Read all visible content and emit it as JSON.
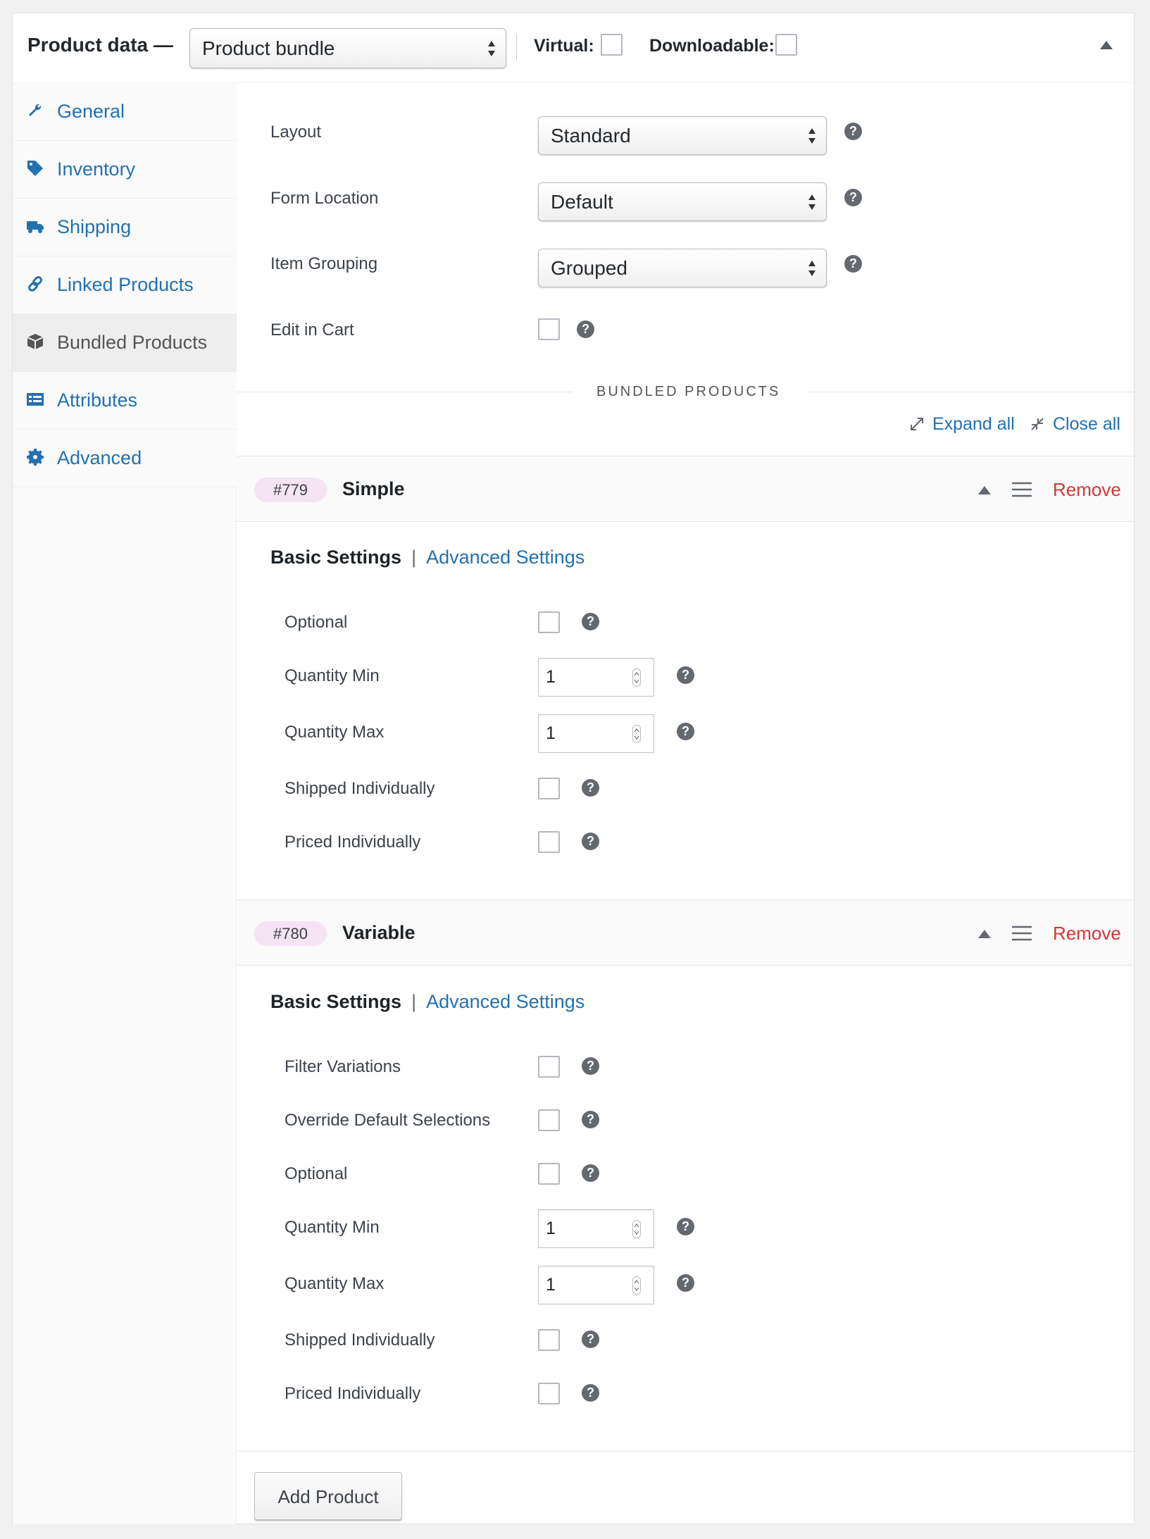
{
  "header": {
    "title": "Product data —",
    "product_type": "Product bundle",
    "virtual_label": "Virtual:",
    "downloadable_label": "Downloadable:"
  },
  "sidebar": {
    "items": [
      {
        "label": "General",
        "icon": "wrench-icon"
      },
      {
        "label": "Inventory",
        "icon": "tag-icon"
      },
      {
        "label": "Shipping",
        "icon": "truck-icon"
      },
      {
        "label": "Linked Products",
        "icon": "link-icon"
      },
      {
        "label": "Bundled Products",
        "icon": "box-icon",
        "active": true
      },
      {
        "label": "Attributes",
        "icon": "list-icon"
      },
      {
        "label": "Advanced",
        "icon": "gear-icon"
      }
    ]
  },
  "settings": {
    "layout": {
      "label": "Layout",
      "value": "Standard"
    },
    "form_location": {
      "label": "Form Location",
      "value": "Default"
    },
    "item_grouping": {
      "label": "Item Grouping",
      "value": "Grouped"
    },
    "edit_in_cart": {
      "label": "Edit in Cart"
    }
  },
  "section_title": "BUNDLED PRODUCTS",
  "actions": {
    "expand_all": "Expand all",
    "close_all": "Close all"
  },
  "help_glyph": "?",
  "items": [
    {
      "id": "#779",
      "title": "Simple",
      "remove": "Remove",
      "basic_tab": "Basic Settings",
      "separator": "|",
      "advanced_tab": "Advanced Settings",
      "fields": {
        "optional": "Optional",
        "qty_min": "Quantity Min",
        "qty_min_value": "1",
        "qty_max": "Quantity Max",
        "qty_max_value": "1",
        "shipped": "Shipped Individually",
        "priced": "Priced Individually"
      }
    },
    {
      "id": "#780",
      "title": "Variable",
      "remove": "Remove",
      "basic_tab": "Basic Settings",
      "separator": "|",
      "advanced_tab": "Advanced Settings",
      "fields": {
        "filter": "Filter Variations",
        "override": "Override Default Selections",
        "optional": "Optional",
        "qty_min": "Quantity Min",
        "qty_min_value": "1",
        "qty_max": "Quantity Max",
        "qty_max_value": "1",
        "shipped": "Shipped Individually",
        "priced": "Priced Individually"
      }
    }
  ],
  "add_product": "Add Product",
  "colors": {
    "link": "#2271b1",
    "remove": "#d63638",
    "badge": "#f4e4f4",
    "help": "#646970"
  }
}
